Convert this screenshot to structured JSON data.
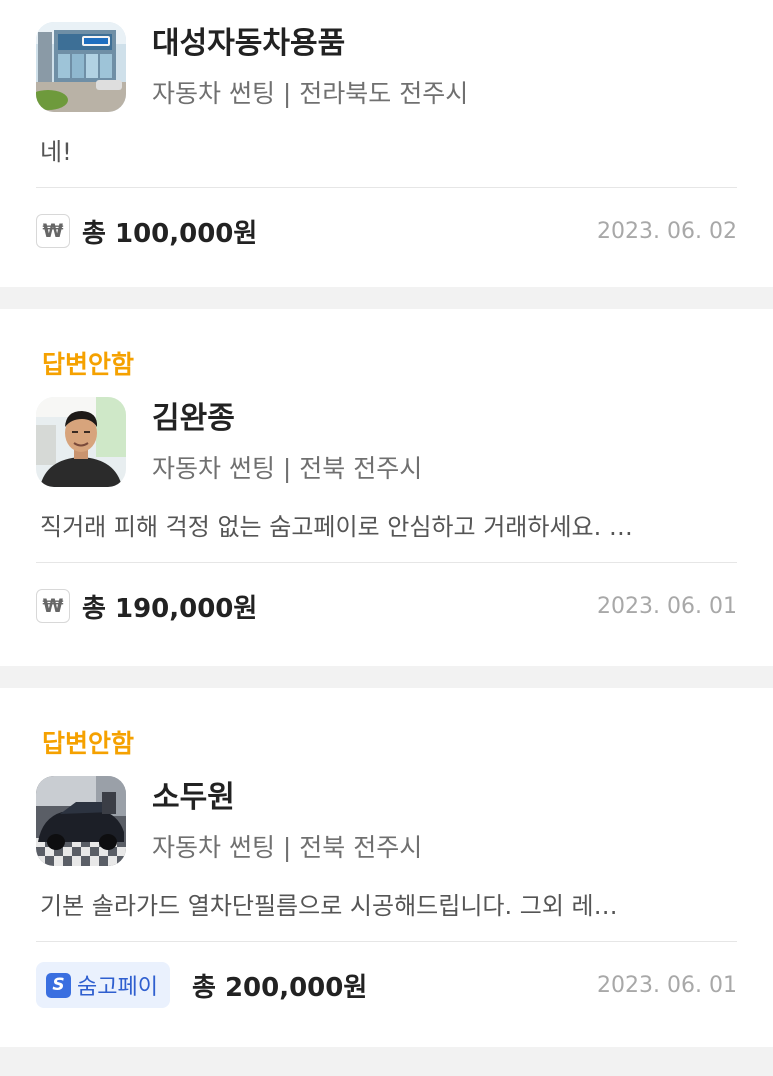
{
  "quotes": [
    {
      "status": "",
      "name": "대성자동차용품",
      "subtitle": "자동차 썬팅 | 전라북도 전주시",
      "message": "네!",
      "payment_badge": "₩",
      "total": "총 100,000원",
      "date": "2023. 06. 02"
    },
    {
      "status": "답변안함",
      "name": "김완종",
      "subtitle": "자동차 썬팅 | 전북 전주시",
      "message": "직거래 피해 걱정 없는 숨고페이로 안심하고 거래하세요. …",
      "payment_badge": "₩",
      "total": "총 190,000원",
      "date": "2023. 06. 01"
    },
    {
      "status": "답변안함",
      "name": "소두원",
      "subtitle": "자동차 썬팅 | 전북 전주시",
      "message": "기본 솔라가드 열차단필름으로 시공해드립니다. 그외 레…",
      "payment_badge_icon": "S",
      "payment_badge": "숨고페이",
      "total": "총 200,000원",
      "date": "2023. 06. 01"
    }
  ],
  "colors": {
    "status": "#f5a100",
    "pay_accent": "#3a6fe0",
    "pay_bg": "#eaf1fd",
    "page_bg": "#f2f2f2"
  }
}
